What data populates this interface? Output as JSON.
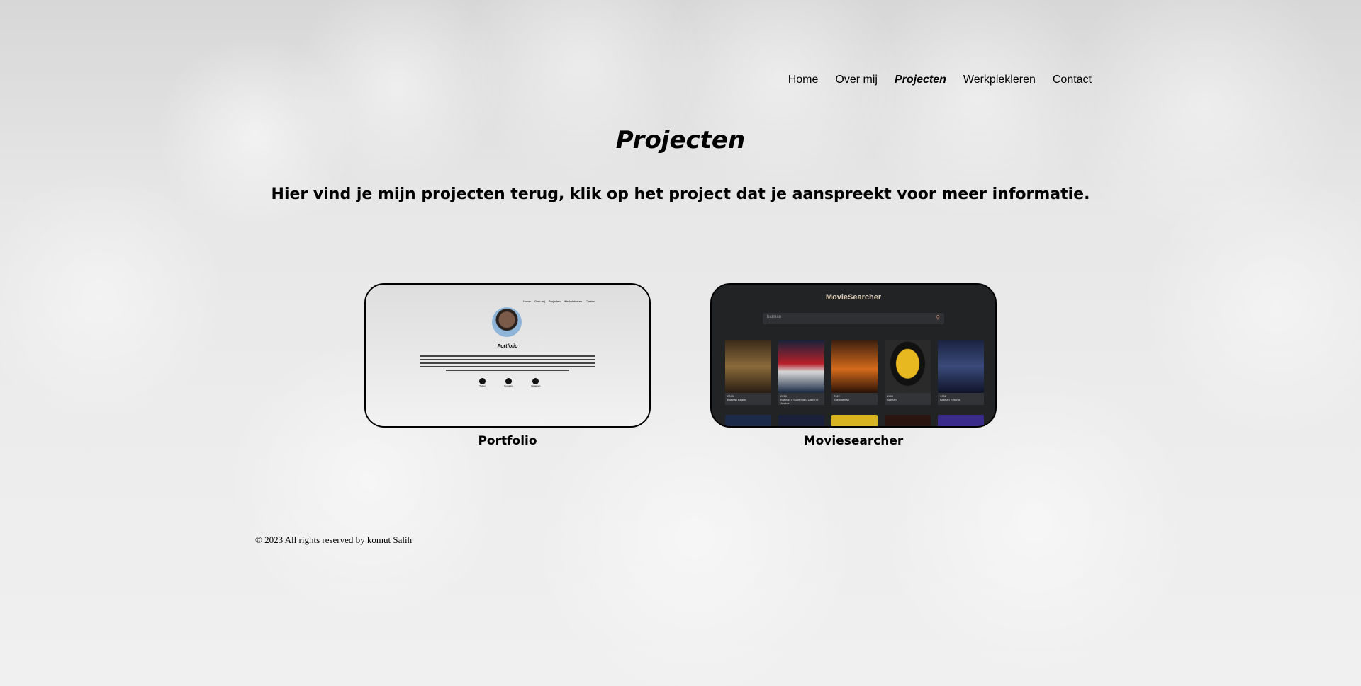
{
  "nav": {
    "items": [
      {
        "label": "Home"
      },
      {
        "label": "Over mij"
      },
      {
        "label": "Projecten"
      },
      {
        "label": "Werkplekleren"
      },
      {
        "label": "Contact"
      }
    ]
  },
  "page": {
    "title": "Projecten",
    "intro": "Hier vind je mijn projecten terug, klik op het project dat je aanspreekt voor meer informatie."
  },
  "projects": [
    {
      "caption": "Portfolio",
      "preview": {
        "nav": [
          "Home",
          "Over mij",
          "Projecten",
          "Werkplekleren",
          "Contact"
        ],
        "title": "Portfolio",
        "icons": [
          "Twitter",
          "Contacto",
          "Instagram"
        ]
      }
    },
    {
      "caption": "Moviesearcher",
      "preview": {
        "logo": "MovieSearcher",
        "search_value": "batman",
        "movies": [
          {
            "year": "2005",
            "title": "Batman Begins"
          },
          {
            "year": "2016",
            "title": "Batman v Superman: Dawn of Justice"
          },
          {
            "year": "2022",
            "title": "The Batman"
          },
          {
            "year": "1989",
            "title": "Batman"
          },
          {
            "year": "1992",
            "title": "Batman Returns"
          }
        ]
      }
    }
  ],
  "footer": {
    "text": "© 2023 All rights reserved by komut Salih"
  }
}
